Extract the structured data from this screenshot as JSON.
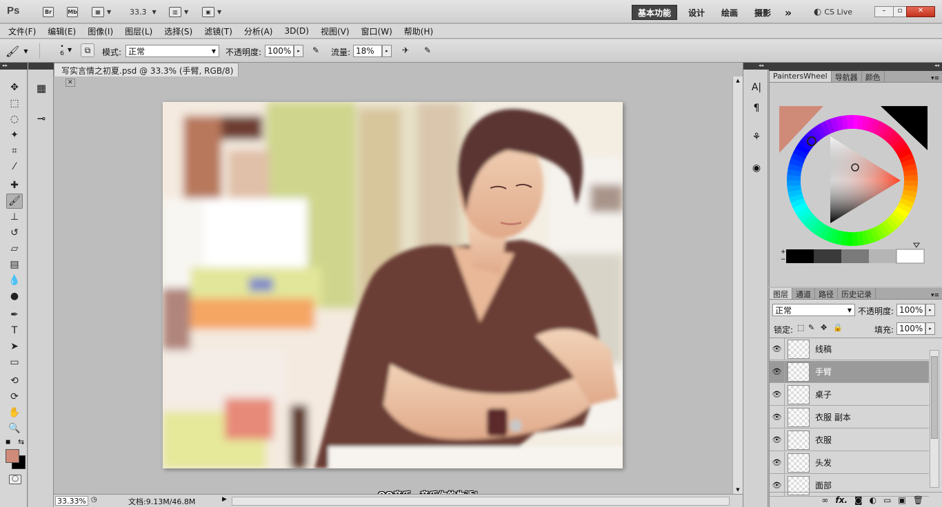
{
  "app": {
    "logo": "Ps",
    "bridge": "Br",
    "minibridge": "Mb",
    "zoom": "33.3"
  },
  "workspaces": [
    "基本功能",
    "设计",
    "绘画",
    "摄影"
  ],
  "workspace_more": "»",
  "cs_live": "CS Live",
  "menu": [
    "文件(F)",
    "编辑(E)",
    "图像(I)",
    "图层(L)",
    "选择(S)",
    "滤镜(T)",
    "分析(A)",
    "3D(D)",
    "视图(V)",
    "窗口(W)",
    "帮助(H)"
  ],
  "options": {
    "brush_size": "6",
    "mode_label": "模式:",
    "mode_value": "正常",
    "opacity_label": "不透明度:",
    "opacity_value": "100%",
    "flow_label": "流量:",
    "flow_value": "18%"
  },
  "document": {
    "tab_title": "写实言情之初夏.psd @ 33.3% (手臂, RGB/8)",
    "close": "✕"
  },
  "status": {
    "zoom": "33.33%",
    "doc_info": "文档:9.13M/46.8M"
  },
  "subtitle": "QQ音乐，音乐你的生活！",
  "color_panel": {
    "tabs": [
      "PaintersWheel",
      "导航器",
      "颜色"
    ],
    "fg_color": "#d08a78",
    "bg_color": "#000000"
  },
  "layers_panel": {
    "tabs": [
      "图层",
      "通道",
      "路径",
      "历史记录"
    ],
    "blend_mode": "正常",
    "opacity_label": "不透明度:",
    "opacity_value": "100%",
    "lock_label": "锁定:",
    "fill_label": "填充:",
    "fill_value": "100%",
    "layers": [
      {
        "name": "线稿",
        "selected": false
      },
      {
        "name": "手臂",
        "selected": true
      },
      {
        "name": "桌子",
        "selected": false
      },
      {
        "name": "衣服 副本",
        "selected": false
      },
      {
        "name": "衣服",
        "selected": false
      },
      {
        "name": "头发",
        "selected": false
      },
      {
        "name": "面部",
        "selected": false
      }
    ],
    "footer_icons": [
      "link-icon",
      "fx-icon",
      "mask-icon",
      "adjustment-icon",
      "group-icon",
      "new-layer-icon",
      "trash-icon"
    ],
    "fx_label": "fx."
  }
}
